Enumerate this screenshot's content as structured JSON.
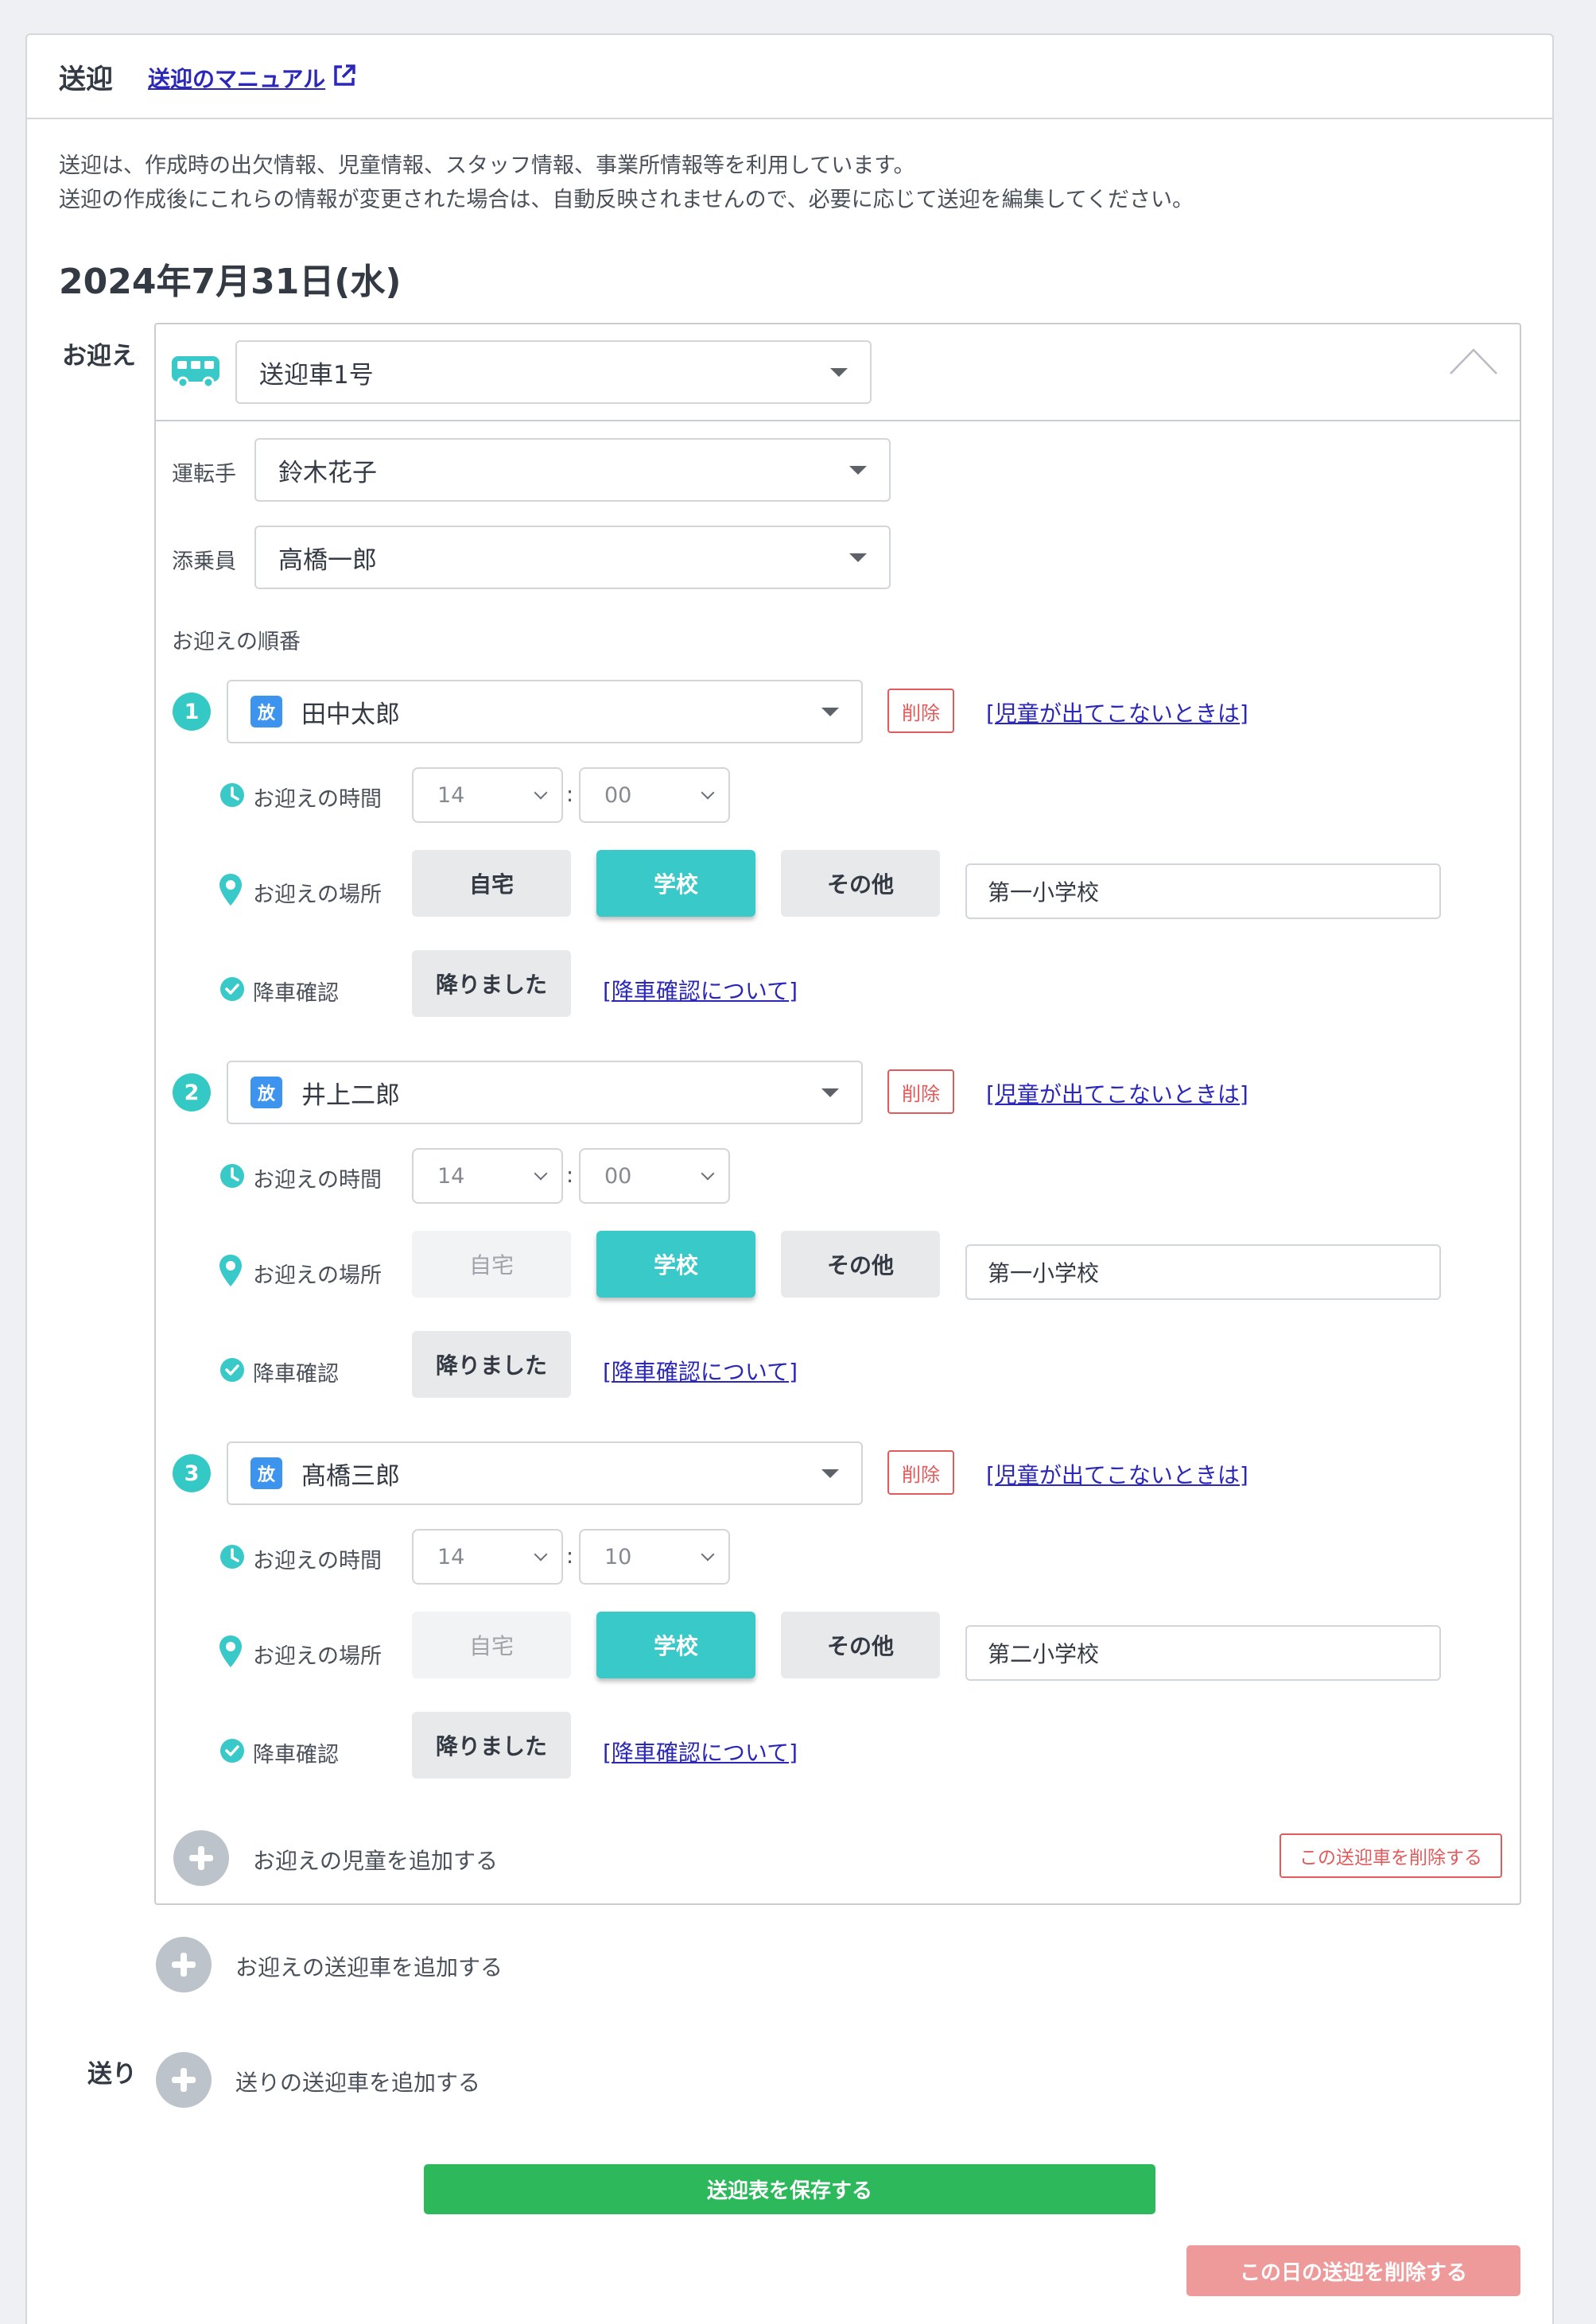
{
  "header": {
    "title": "送迎",
    "manual_link": "送迎のマニュアル"
  },
  "description": {
    "line1": "送迎は、作成時の出欠情報、児童情報、スタッフ情報、事業所情報等を利用しています。",
    "line2": "送迎の作成後にこれらの情報が変更された場合は、自動反映されませんので、必要に応じて送迎を編集してください。"
  },
  "date": "2024年7月31日(水)",
  "pickup": {
    "section_label": "お迎え",
    "vehicle": "送迎車1号",
    "driver_label": "運転手",
    "driver": "鈴木花子",
    "attendant_label": "添乗員",
    "attendant": "高橋一郎",
    "order_label": "お迎えの順番",
    "children": [
      {
        "number": "1",
        "badge": "放",
        "name": "田中太郎",
        "delete": "削除",
        "help_link": "[児童が出てこないときは]",
        "time_label": "お迎えの時間",
        "hour": "14",
        "minute": "00",
        "colon": ":",
        "place_label": "お迎えの場所",
        "place_home": "自宅",
        "place_school": "学校",
        "place_other": "その他",
        "place_value": "第一小学校",
        "confirm_label": "降車確認",
        "confirm_button": "降りました",
        "confirm_link": "[降車確認について]"
      },
      {
        "number": "2",
        "badge": "放",
        "name": "井上二郎",
        "delete": "削除",
        "help_link": "[児童が出てこないときは]",
        "time_label": "お迎えの時間",
        "hour": "14",
        "minute": "00",
        "colon": ":",
        "place_label": "お迎えの場所",
        "place_home": "自宅",
        "place_school": "学校",
        "place_other": "その他",
        "place_value": "第一小学校",
        "confirm_label": "降車確認",
        "confirm_button": "降りました",
        "confirm_link": "[降車確認について]"
      },
      {
        "number": "3",
        "badge": "放",
        "name": "髙橋三郎",
        "delete": "削除",
        "help_link": "[児童が出てこないときは]",
        "time_label": "お迎えの時間",
        "hour": "14",
        "minute": "10",
        "colon": ":",
        "place_label": "お迎えの場所",
        "place_home": "自宅",
        "place_school": "学校",
        "place_other": "その他",
        "place_value": "第二小学校",
        "confirm_label": "降車確認",
        "confirm_button": "降りました",
        "confirm_link": "[降車確認について]"
      }
    ],
    "add_child": "お迎えの児童を追加する",
    "delete_vehicle": "この送迎車を削除する",
    "add_vehicle": "お迎えの送迎車を追加する"
  },
  "dropoff": {
    "section_label": "送り",
    "add_vehicle": "送りの送迎車を追加する"
  },
  "actions": {
    "save": "送迎表を保存する",
    "delete_day": "この日の送迎を削除する"
  },
  "colors": {
    "accent_teal": "#38c9c8",
    "badge_blue": "#3d94ee",
    "save_green": "#2eb85c",
    "danger_red": "#e05b5b",
    "delete_day_pink": "#ef9a9a",
    "link_blue": "#2b27b8"
  },
  "icons": {
    "external_link": "external-link-icon",
    "bus": "bus-icon",
    "collapse": "chevron-up-icon",
    "clock": "clock-icon",
    "location": "map-pin-icon",
    "check": "check-circle-icon",
    "plus": "plus-circle-icon"
  }
}
